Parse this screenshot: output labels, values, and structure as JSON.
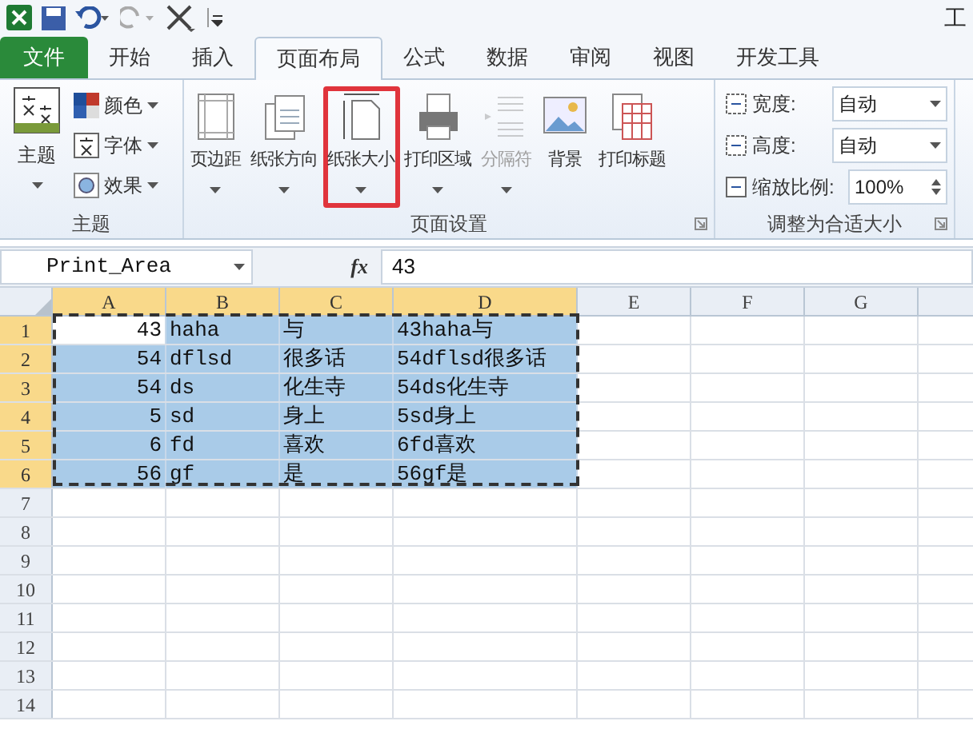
{
  "title_fragment": "工",
  "tabs": [
    {
      "label": "文件",
      "kind": "file",
      "selected": false
    },
    {
      "label": "开始",
      "kind": "tab",
      "selected": false
    },
    {
      "label": "插入",
      "kind": "tab",
      "selected": false
    },
    {
      "label": "页面布局",
      "kind": "tab",
      "selected": true
    },
    {
      "label": "公式",
      "kind": "tab",
      "selected": false
    },
    {
      "label": "数据",
      "kind": "tab",
      "selected": false
    },
    {
      "label": "审阅",
      "kind": "tab",
      "selected": false
    },
    {
      "label": "视图",
      "kind": "tab",
      "selected": false
    },
    {
      "label": "开发工具",
      "kind": "tab",
      "selected": false
    }
  ],
  "theme_group": {
    "title": "主题",
    "main": "主题",
    "items": [
      {
        "label": "颜色",
        "kind": "colors"
      },
      {
        "label": "字体",
        "kind": "fonts"
      },
      {
        "label": "效果",
        "kind": "effects"
      }
    ]
  },
  "page_setup": {
    "title": "页面设置",
    "buttons": [
      {
        "label": "页边距",
        "kind": "margins",
        "disabled": false,
        "highlighted": false,
        "dropdown": true
      },
      {
        "label": "纸张方向",
        "kind": "orientation",
        "disabled": false,
        "highlighted": false,
        "dropdown": true
      },
      {
        "label": "纸张大小",
        "kind": "size",
        "disabled": false,
        "highlighted": true,
        "dropdown": true
      },
      {
        "label": "打印区域",
        "kind": "print_area",
        "disabled": false,
        "highlighted": false,
        "dropdown": true
      },
      {
        "label": "分隔符",
        "kind": "breaks",
        "disabled": true,
        "highlighted": false,
        "dropdown": true
      },
      {
        "label": "背景",
        "kind": "background",
        "disabled": false,
        "highlighted": false,
        "dropdown": false
      },
      {
        "label": "打印标题",
        "kind": "titles",
        "disabled": false,
        "highlighted": false,
        "dropdown": false
      }
    ]
  },
  "scale_group": {
    "title": "调整为合适大小",
    "rows": [
      {
        "label": "宽度:",
        "value": "自动",
        "kind": "dropdown"
      },
      {
        "label": "高度:",
        "value": "自动",
        "kind": "dropdown"
      },
      {
        "label": "缩放比例:",
        "value": "100%",
        "kind": "spin"
      }
    ]
  },
  "formula_bar": {
    "name_box": "Print_Area",
    "fx": "fx",
    "value": "43"
  },
  "sheet": {
    "columns": [
      {
        "label": "A",
        "selected": true
      },
      {
        "label": "B",
        "selected": true
      },
      {
        "label": "C",
        "selected": true
      },
      {
        "label": "D",
        "selected": true
      },
      {
        "label": "E",
        "selected": false
      },
      {
        "label": "F",
        "selected": false
      },
      {
        "label": "G",
        "selected": false
      }
    ],
    "rows": [
      {
        "label": "1",
        "selected": true,
        "cells": [
          {
            "value": "43",
            "selected": true,
            "active": true
          },
          {
            "value": "haha",
            "selected": true,
            "active": false
          },
          {
            "value": "与",
            "selected": true,
            "active": false
          },
          {
            "value": "43haha与",
            "selected": true,
            "active": false
          }
        ]
      },
      {
        "label": "2",
        "selected": true,
        "cells": [
          {
            "value": "54",
            "selected": true,
            "active": false
          },
          {
            "value": "dflsd",
            "selected": true,
            "active": false
          },
          {
            "value": "很多话",
            "selected": true,
            "active": false
          },
          {
            "value": "54dflsd很多话",
            "selected": true,
            "active": false
          }
        ]
      },
      {
        "label": "3",
        "selected": true,
        "cells": [
          {
            "value": "54",
            "selected": true,
            "active": false
          },
          {
            "value": "ds",
            "selected": true,
            "active": false
          },
          {
            "value": "化生寺",
            "selected": true,
            "active": false
          },
          {
            "value": "54ds化生寺",
            "selected": true,
            "active": false
          }
        ]
      },
      {
        "label": "4",
        "selected": true,
        "cells": [
          {
            "value": "5",
            "selected": true,
            "active": false
          },
          {
            "value": "sd",
            "selected": true,
            "active": false
          },
          {
            "value": "身上",
            "selected": true,
            "active": false
          },
          {
            "value": "5sd身上",
            "selected": true,
            "active": false
          }
        ]
      },
      {
        "label": "5",
        "selected": true,
        "cells": [
          {
            "value": "6",
            "selected": true,
            "active": false
          },
          {
            "value": "fd",
            "selected": true,
            "active": false
          },
          {
            "value": "喜欢",
            "selected": true,
            "active": false
          },
          {
            "value": "6fd喜欢",
            "selected": true,
            "active": false
          }
        ]
      },
      {
        "label": "6",
        "selected": true,
        "cells": [
          {
            "value": "56",
            "selected": true,
            "active": false
          },
          {
            "value": "gf",
            "selected": true,
            "active": false
          },
          {
            "value": "是",
            "selected": true,
            "active": false
          },
          {
            "value": "56gf是",
            "selected": true,
            "active": false
          }
        ]
      },
      {
        "label": "7",
        "selected": false,
        "cells": []
      },
      {
        "label": "8",
        "selected": false,
        "cells": []
      },
      {
        "label": "9",
        "selected": false,
        "cells": []
      },
      {
        "label": "10",
        "selected": false,
        "cells": []
      },
      {
        "label": "11",
        "selected": false,
        "cells": []
      },
      {
        "label": "12",
        "selected": false,
        "cells": []
      },
      {
        "label": "13",
        "selected": false,
        "cells": []
      },
      {
        "label": "14",
        "selected": false,
        "cells": []
      }
    ]
  }
}
